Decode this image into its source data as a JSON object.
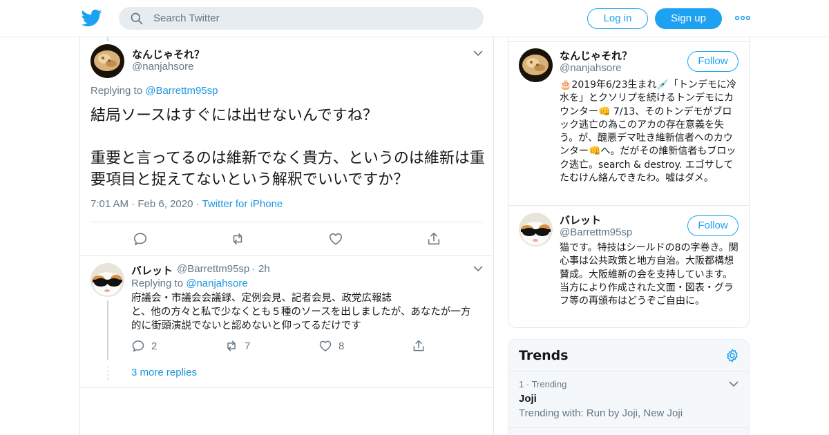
{
  "header": {
    "search_placeholder": "Search Twitter",
    "login_label": "Log in",
    "signup_label": "Sign up",
    "brand_color": "#1da1f2"
  },
  "main_tweet": {
    "name": "なんじゃそれ？",
    "handle": "@nanjahsore",
    "replying_prefix": "Replying to",
    "replying_to": "@Barrettm95sp",
    "text": "結局ソースはすぐには出せないんですね？\n\n重要と言ってるのは維新でなく貴方、というのは維新は重要項目と捉えてないという解釈でいいですか？",
    "time": "7:01 AM",
    "date": "Feb 6, 2020",
    "source": "Twitter for iPhone"
  },
  "reply_tweet": {
    "name": "バレット",
    "handle": "@Barrettm95sp",
    "age": "2h",
    "replying_prefix": "Replying to",
    "replying_to": "@nanjahsore",
    "text": "府議会・市議会会議録、定例会見、記者会見、政党広報誌\nと、他の方々と私で少なくとも５種のソースを出しましたが、あなたが一方的に街頭演説でないと認めないと仰ってるだけです",
    "reply_count": "2",
    "retweet_count": "7",
    "like_count": "8",
    "more_replies": "3 more replies"
  },
  "sidebar": {
    "users": [
      {
        "name": "なんじゃそれ？",
        "handle": "@nanjahsore",
        "follow_label": "Follow",
        "bio": "🎂2019年6/23生まれ💉「トンデモに冷水を」とクソリプを続けるトンデモにカウンター👊 7/13、そのトンデモがブロック逃亡の為このアカの存在意義を失う。が、醜悪デマ吐き維新信者へのカウンター👊へ。だがその維新信者もブロック逃亡。search & destroy. エゴサしてたむけん絡んできたわ。嘘はダメ。"
      },
      {
        "name": "バレット",
        "handle": "@Barrettm95sp",
        "follow_label": "Follow",
        "bio": "猫です。特技はシールドの8の字巻き。関心事は公共政策と地方自治。大阪都構想賛成。大阪維新の会を支持しています。当方により作成された文面・図表・グラフ等の再頒布はどうぞご自由に。"
      }
    ],
    "trends": {
      "title": "Trends",
      "items": [
        {
          "rank": "1",
          "context": "Trending",
          "name": "Joji",
          "with": "Trending with: Run by Joji, New Joji"
        }
      ]
    }
  }
}
